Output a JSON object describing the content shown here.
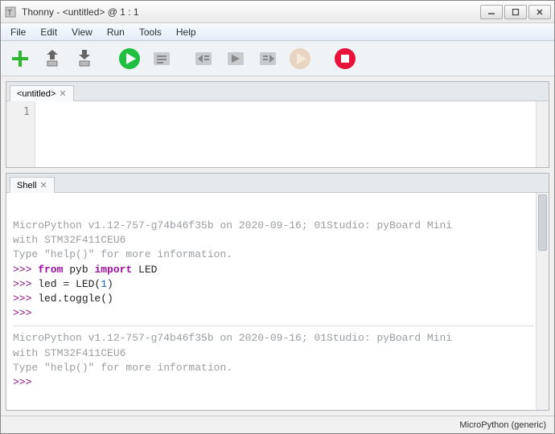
{
  "window": {
    "title": "Thonny  -  <untitled>  @  1 : 1"
  },
  "menu": {
    "file": "File",
    "edit": "Edit",
    "view": "View",
    "run": "Run",
    "tools": "Tools",
    "help": "Help"
  },
  "toolbar_icons": {
    "new": "new-file",
    "open": "open-file",
    "save": "save-file",
    "run": "run-script",
    "debug": "debug-step",
    "step_over": "step-over",
    "step_into": "step-into",
    "step_out": "step-out",
    "resume": "resume",
    "stop": "stop"
  },
  "editor": {
    "tab_label": "<untitled>",
    "line1": "1"
  },
  "shell": {
    "tab_label": "Shell",
    "banner1": "MicroPython v1.12-757-g74b46f35b on 2020-09-16; 01Studio: pyBoard Mini",
    "banner2": "with STM32F411CEU6",
    "banner3": "Type \"help()\" for more information.",
    "p": ">>>",
    "l1_pre": " from ",
    "l1_mod": "pyb ",
    "l1_imp": "import ",
    "l1_name": "LED",
    "l2": " led = LED(",
    "l2_num": "1",
    "l2_end": ")",
    "l3": " led.toggle()",
    "banner1b": "MicroPython v1.12-757-g74b46f35b on 2020-09-16; 01Studio: pyBoard Mini",
    "banner2b": "with STM32F411CEU6",
    "banner3b": "Type \"help()\" for more information."
  },
  "status": {
    "interpreter": "MicroPython (generic)"
  }
}
